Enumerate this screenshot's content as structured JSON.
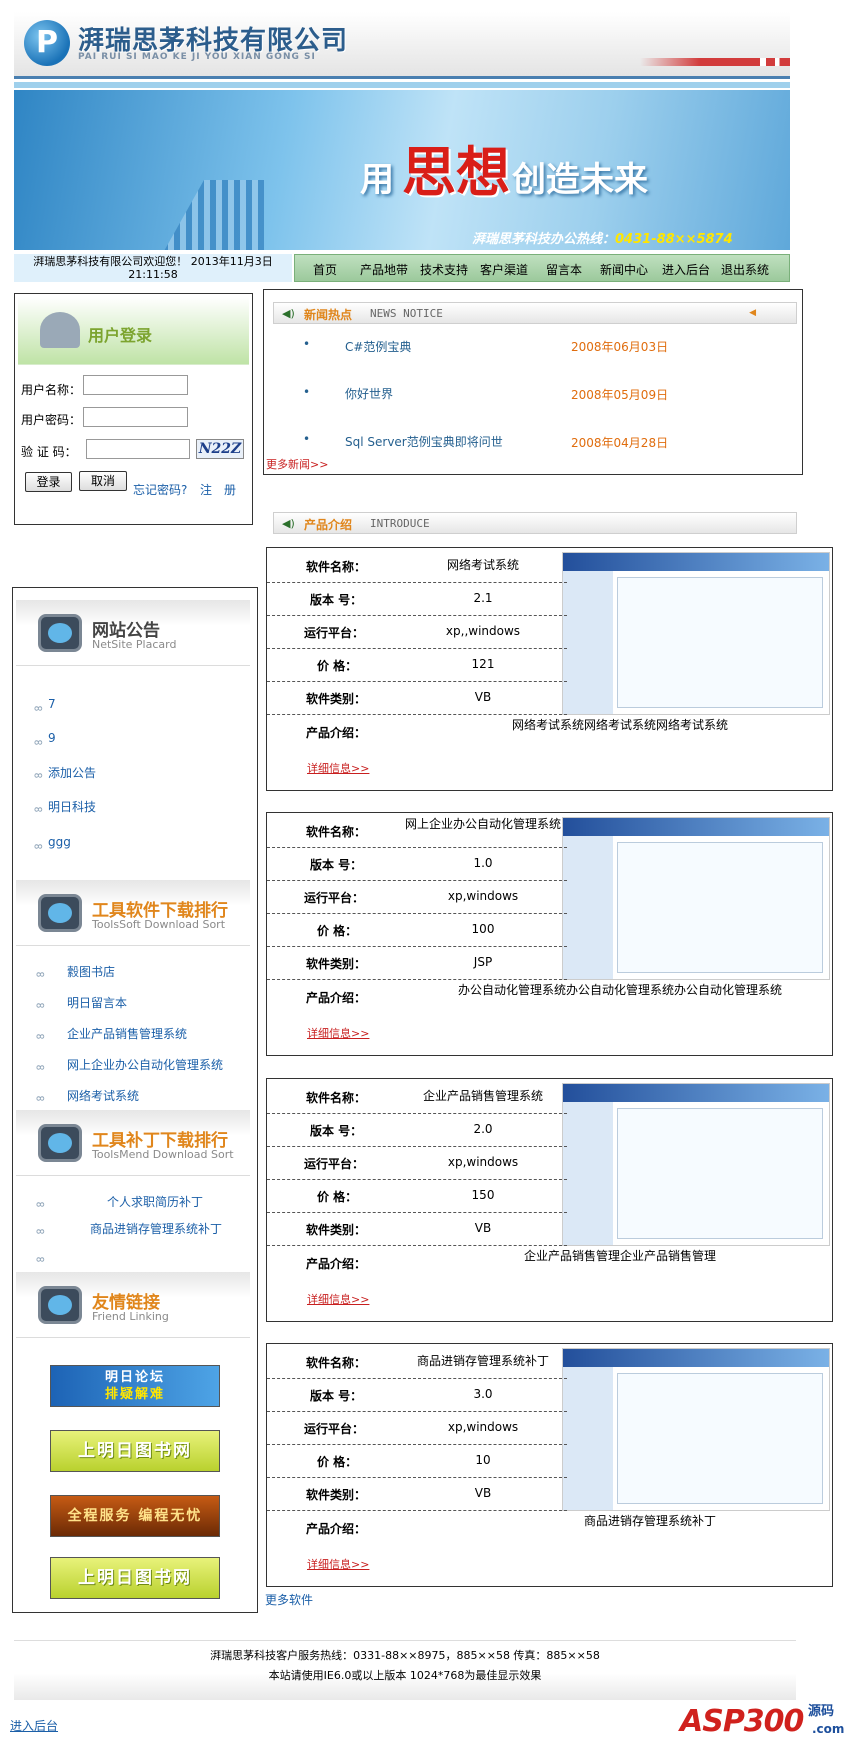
{
  "header": {
    "company_name": "湃瑞思茅科技有限公司",
    "company_pinyin": "PAI RUI SI MAO KE JI YOU XIAN GONG SI",
    "logo_letter": "P"
  },
  "banner": {
    "slogan_pre": "用",
    "slogan_main": "思想",
    "slogan_post": "创造未来",
    "hotline_label": "湃瑞思茅科技办公热线：",
    "hotline_number": "0431-88××5874"
  },
  "welcome": {
    "line1": "湃瑞思茅科技有限公司欢迎您！ 2013年11月3日",
    "line2": "21:11:58"
  },
  "nav": [
    "首页",
    "产品地带",
    "技术支持",
    "客户渠道",
    "留言本",
    "新闻中心",
    "进入后台",
    "退出系统"
  ],
  "login": {
    "title": "用户登录",
    "username_label": "用户名称：",
    "password_label": "用户密码：",
    "captcha_label": "验 证 码：",
    "captcha_text": "N22Z",
    "login_button": "登录",
    "cancel_button": "取消",
    "forgot_link": "忘记密码?",
    "register_link": "注　册"
  },
  "news": {
    "title_cn": "新闻热点",
    "title_en": "NEWS NOTICE",
    "items": [
      {
        "title": "C#范例宝典",
        "date": "2008年06月03日"
      },
      {
        "title": "你好世界",
        "date": "2008年05月09日"
      },
      {
        "title": "Sql Server范例宝典即将问世",
        "date": "2008年04月28日"
      }
    ],
    "more": "更多新闻>>"
  },
  "intro_head": {
    "title_cn": "产品介绍",
    "title_en": "INTRODUCE"
  },
  "placard": {
    "title_cn": "网站公告",
    "title_en": "NetSite Placard",
    "items": [
      "7",
      "9",
      "添加公告",
      "明日科技",
      "ggg"
    ]
  },
  "downloads": {
    "title_cn": "工具软件下载排行",
    "title_en": "ToolsSoft Download Sort",
    "items": [
      "縠图书店",
      "明日留言本",
      "企业产品销售管理系统",
      "网上企业办公自动化管理系统",
      "网络考试系统"
    ]
  },
  "patches": {
    "title_cn": "工具补丁下载排行",
    "title_en": "ToolsMend Download Sort",
    "items": [
      "个人求职简历补丁",
      "商品进销存管理系统补丁",
      ""
    ]
  },
  "links": {
    "title_cn": "友情链接",
    "title_en": "Friend Linking",
    "badges": [
      {
        "text": "明日论坛 排疑解难",
        "line1": "明日论坛",
        "line2": "排疑解难"
      },
      {
        "text": "上明日图书网"
      },
      {
        "text": "全程服务 编程无忧"
      },
      {
        "text": "上明日图书网"
      }
    ]
  },
  "product_labels": {
    "name": "软件名称：",
    "version": "版本 号：",
    "platform": "运行平台：",
    "price": "价 格：",
    "category": "软件类别：",
    "intro": "产品介绍：",
    "detail": "详细信息>>"
  },
  "products": [
    {
      "name": "网络考试系统",
      "version": "2.1",
      "platform": "xp,,windows",
      "price": "121",
      "category": "VB",
      "intro": "网络考试系统网络考试系统网络考试系统"
    },
    {
      "name": "网上企业办公自动化管理系统",
      "version": "1.0",
      "platform": "xp,windows",
      "price": "100",
      "category": "JSP",
      "intro": "办公自动化管理系统办公自动化管理系统办公自动化管理系统"
    },
    {
      "name": "企业产品销售管理系统",
      "version": "2.0",
      "platform": "xp,windows",
      "price": "150",
      "category": "VB",
      "intro": "企业产品销售管理企业产品销售管理"
    },
    {
      "name": "商品进销存管理系统补丁",
      "version": "3.0",
      "platform": "xp,windows",
      "price": "10",
      "category": "VB",
      "intro": "商品进销存管理系统补丁"
    }
  ],
  "more_software": "更多软件",
  "footer": {
    "line1": "湃瑞思茅科技客户服务热线：0331-88××8975，885××58 传真：885××58",
    "line2": "本站请使用IE6.0或以上版本 1024*768为最佳显示效果",
    "admin_link": "进入后台"
  },
  "watermark": {
    "text": "ASP300",
    "sub": "源码",
    "com": ".com"
  },
  "colors": {
    "nav_green": "#9cc99c",
    "accent_orange": "#e0861c",
    "date_orange": "#e06d0e",
    "link_blue": "#1b5fa8",
    "detail_red": "#c81f1f"
  }
}
